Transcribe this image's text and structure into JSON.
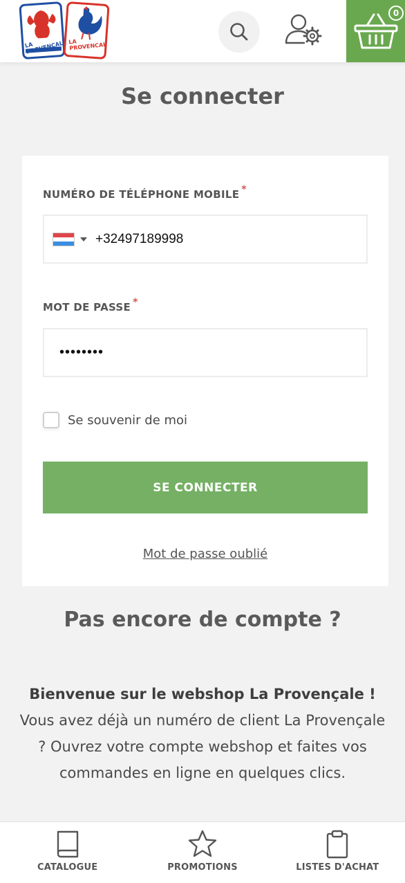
{
  "header": {
    "logo_left_text": "LA PROVENCALE",
    "logo_right_text": "LA PROVENCALE",
    "cart_count": "0",
    "brand_color": "#6aa84f"
  },
  "page": {
    "title": "Se connecter"
  },
  "login_form": {
    "phone_label": "NUMÉRO DE TÉLÉPHONE MOBILE",
    "phone_required": "*",
    "phone_value": "+32497189998",
    "password_label": "MOT DE PASSE",
    "password_required": "*",
    "password_value": "••••••••",
    "remember_label": "Se souvenir de moi",
    "remember_checked": false,
    "submit_label": "SE CONNECTER",
    "forgot_label": "Mot de passe oublié"
  },
  "signup": {
    "title": "Pas encore de compte ?",
    "welcome_strong": "Bienvenue sur le webshop La Provençale !",
    "welcome_text": "Vous avez déjà un numéro de client La Provençale ? Ouvrez votre compte webshop et faites vos commandes en ligne en quelques clics."
  },
  "bottom_nav": {
    "items": [
      {
        "label": "CATALOGUE",
        "icon": "book-icon"
      },
      {
        "label": "PROMOTIONS",
        "icon": "star-icon"
      },
      {
        "label": "LISTES D'ACHAT",
        "icon": "clipboard-icon"
      }
    ]
  }
}
